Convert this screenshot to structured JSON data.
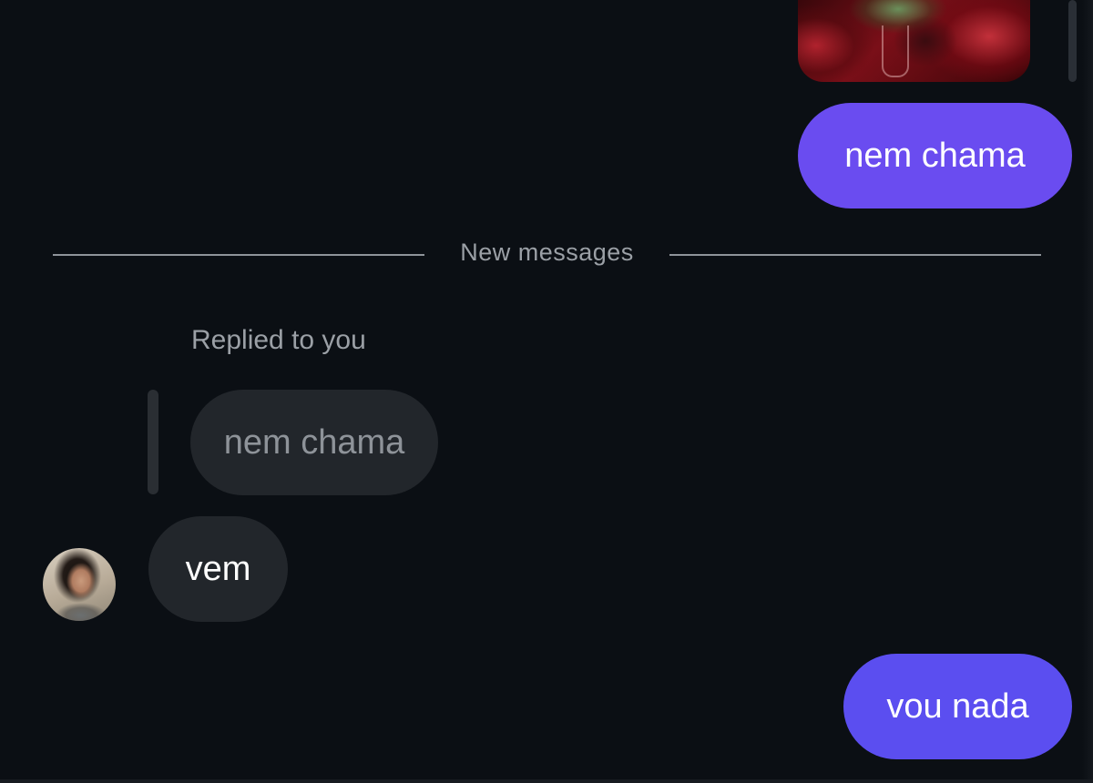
{
  "conversation": {
    "divider_label": "New messages",
    "messages": [
      {
        "type": "image",
        "direction": "sent",
        "alt_icon": "photo"
      },
      {
        "type": "text",
        "direction": "sent",
        "text": "nem chama"
      },
      {
        "type": "reply",
        "direction": "received",
        "reply_caption": "Replied to you",
        "quoted_text": "nem chama",
        "text": "vem"
      },
      {
        "type": "text",
        "direction": "sent",
        "text": "vou nada"
      }
    ]
  },
  "colors": {
    "background": "#0b0f14",
    "sent_bubble": "#6a4cf0",
    "received_bubble": "#22262b",
    "muted_text": "#9ba0a6"
  }
}
